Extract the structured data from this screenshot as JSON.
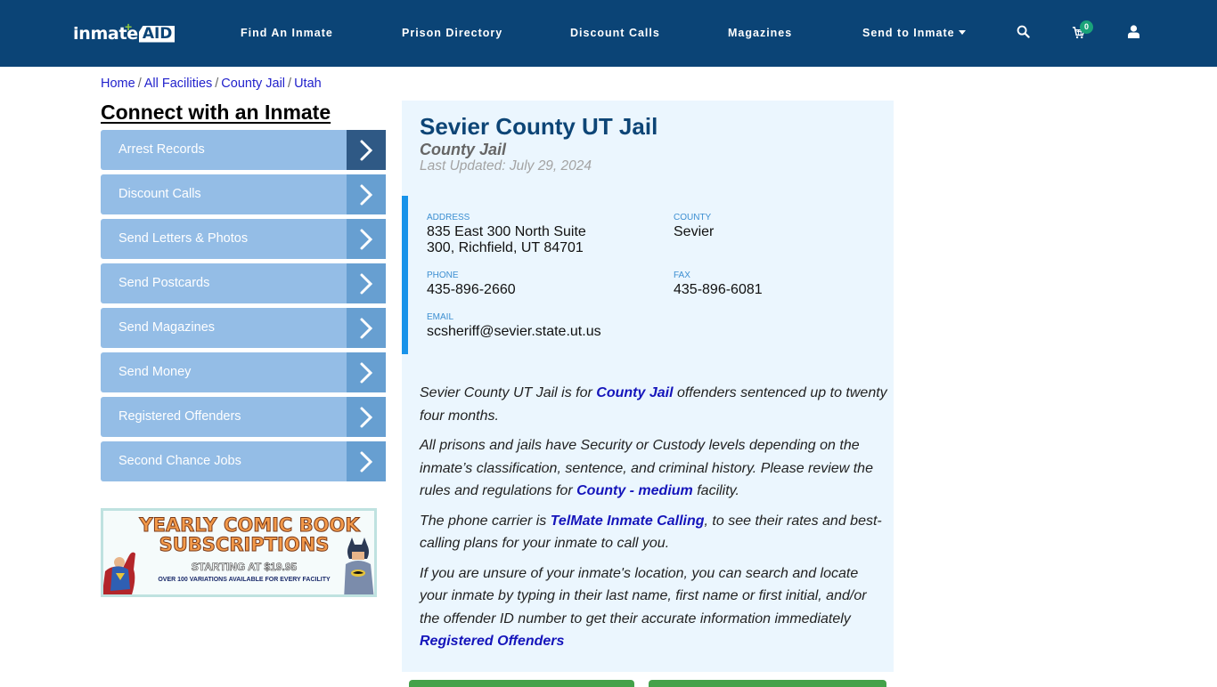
{
  "header": {
    "logo_text": "inmate",
    "logo_badge": "AID",
    "nav": [
      {
        "label": "Find An Inmate"
      },
      {
        "label": "Prison Directory"
      },
      {
        "label": "Discount Calls"
      },
      {
        "label": "Magazines"
      },
      {
        "label": "Send to Inmate",
        "has_dropdown": true
      }
    ],
    "icons": [
      "search-icon",
      "cart-icon",
      "user-icon"
    ],
    "cart_count": "0"
  },
  "breadcrumb": [
    {
      "label": "Home"
    },
    {
      "label": "All Facilities"
    },
    {
      "label": "County Jail"
    },
    {
      "label": "Utah"
    }
  ],
  "breadcrumb_separator": "/",
  "sidebar": {
    "title": "Connect with an Inmate",
    "items": [
      {
        "label": "Arrest Records",
        "active": true
      },
      {
        "label": "Discount Calls"
      },
      {
        "label": "Send Letters & Photos"
      },
      {
        "label": "Send Postcards"
      },
      {
        "label": "Send Magazines"
      },
      {
        "label": "Send Money"
      },
      {
        "label": "Registered Offenders"
      },
      {
        "label": "Second Chance Jobs"
      }
    ],
    "ad": {
      "line1": "YEARLY COMIC BOOK",
      "line2": "SUBSCRIPTIONS",
      "line3": "STARTING AT $19.95",
      "line4": "OVER 100 VARIATIONS AVAILABLE FOR EVERY FACILITY"
    }
  },
  "facility": {
    "name": "Sevier County UT Jail",
    "type": "County Jail",
    "last_updated": "Last Updated: July 29, 2024",
    "info": {
      "address_label": "ADDRESS",
      "address_line1": "835 East 300 North Suite",
      "address_line2": "300, Richfield, UT 84701",
      "county_label": "COUNTY",
      "county": "Sevier",
      "phone_label": "PHONE",
      "phone": "435-896-2660",
      "fax_label": "FAX",
      "fax": "435-896-6081",
      "email_label": "EMAIL",
      "email": "scsheriff@sevier.state.ut.us"
    },
    "description": {
      "p1_before": "Sevier County UT Jail is for ",
      "p1_link": "County Jail",
      "p1_after": " offenders sentenced up to twenty four months.",
      "p2_before": "All prisons and jails have Security or Custody levels depending on the inmate’s classification, sentence, and criminal history. Please review the rules and regulations for ",
      "p2_link": "County - medium",
      "p2_after": " facility.",
      "p3_before": "The phone carrier is ",
      "p3_link": "TelMate Inmate Calling",
      "p3_after": ", to see their rates and best-calling plans for your inmate to call you.",
      "p4_text": "If you are unsure of your inmate's location, you can search and locate your inmate by typing in their last name, first name or first initial, and/or the offender ID number to get their accurate information immediately",
      "p4_link": "Registered Offenders"
    }
  },
  "colors": {
    "header_bg": "#0b4476",
    "sidebar_item": "#94bde6",
    "sidebar_arrow": "#679fd1",
    "sidebar_arrow_active": "#2f5985",
    "panel_bg": "#ebf6fe",
    "accent_border": "#1893ea",
    "title": "#0d4576",
    "button_green": "#44a24a"
  }
}
